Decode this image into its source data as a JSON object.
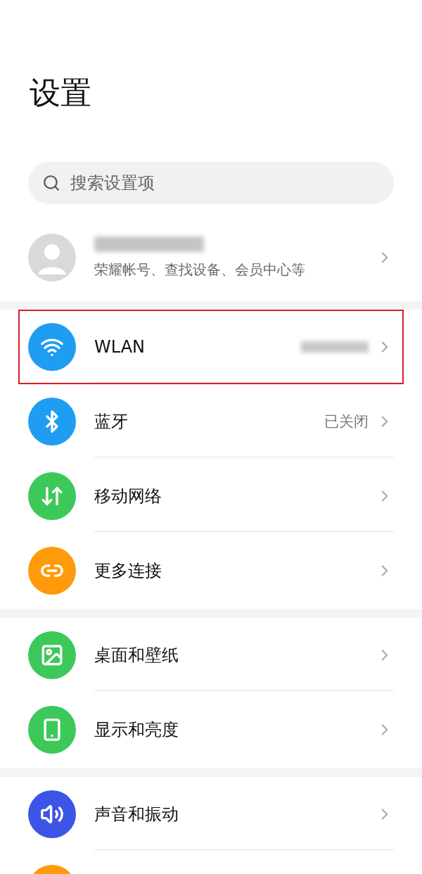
{
  "title": "设置",
  "search": {
    "placeholder": "搜索设置项"
  },
  "account": {
    "name_blurred": true,
    "subtitle": "荣耀帐号、查找设备、会员中心等"
  },
  "sections": [
    {
      "items": [
        {
          "kind": "wifi",
          "color": "#1f9df2",
          "label": "WLAN",
          "blurred_value": true,
          "highlighted": true
        },
        {
          "kind": "bluetooth",
          "color": "#1f9df2",
          "label": "蓝牙",
          "value": "已关闭",
          "highlighted": false
        },
        {
          "kind": "updown",
          "color": "#3cc95a",
          "label": "移动网络",
          "highlighted": false
        },
        {
          "kind": "link",
          "color": "#ff9a0a",
          "label": "更多连接",
          "highlighted": false
        }
      ]
    },
    {
      "items": [
        {
          "kind": "image",
          "color": "#3cc95a",
          "label": "桌面和壁纸",
          "highlighted": false
        },
        {
          "kind": "phone",
          "color": "#3cc95a",
          "label": "显示和亮度",
          "highlighted": false
        }
      ]
    },
    {
      "items": [
        {
          "kind": "sound",
          "color": "#3d55e6",
          "label": "声音和振动",
          "highlighted": false
        },
        {
          "kind": "partial",
          "color": "#ff9a0a"
        }
      ]
    }
  ]
}
